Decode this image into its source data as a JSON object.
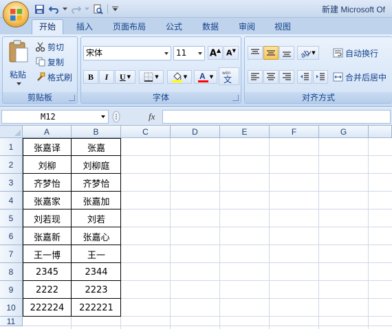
{
  "window": {
    "title": "新建 Microsoft Of"
  },
  "tabs": [
    "开始",
    "插入",
    "页面布局",
    "公式",
    "数据",
    "审阅",
    "视图"
  ],
  "clipboard": {
    "paste": "粘贴",
    "cut": "剪切",
    "copy": "复制",
    "format_painter": "格式刷",
    "label": "剪贴板"
  },
  "font": {
    "name": "宋体",
    "size": "11",
    "bold": "B",
    "italic": "I",
    "underline": "U",
    "label": "字体"
  },
  "alignment": {
    "wrap_text": "自动换行",
    "merge_center": "合并后居中",
    "label": "对齐方式"
  },
  "formula_bar": {
    "name_box": "M12",
    "fx": "fx",
    "value": ""
  },
  "columns": [
    "A",
    "B",
    "C",
    "D",
    "E",
    "F",
    "G"
  ],
  "rows": [
    "1",
    "2",
    "3",
    "4",
    "5",
    "6",
    "7",
    "8",
    "9",
    "10",
    "11"
  ],
  "cells": [
    [
      "张嘉译",
      "张嘉"
    ],
    [
      "刘柳",
      "刘柳庭"
    ],
    [
      "齐梦怡",
      "齐梦恰"
    ],
    [
      "张嘉家",
      "张嘉加"
    ],
    [
      "刘若现",
      "刘若"
    ],
    [
      "张嘉新",
      "张嘉心"
    ],
    [
      "王一博",
      "王一"
    ],
    [
      "2345",
      "2344"
    ],
    [
      "2222",
      "2223"
    ],
    [
      "222224",
      "222221"
    ]
  ],
  "colors": {
    "accent": "#15428b",
    "highlight_yellow": "#ffff00",
    "font_red": "#ff0000"
  }
}
